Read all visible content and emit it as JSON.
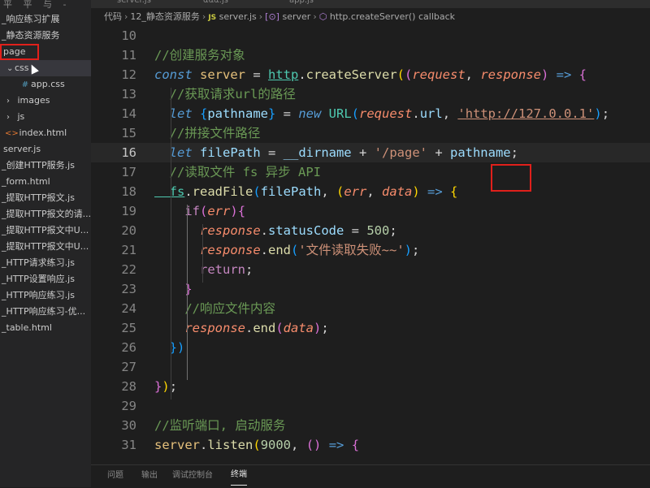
{
  "sidebar": {
    "top_text": "平 平 与 -",
    "items": [
      {
        "label": "_响应练习扩展"
      },
      {
        "label": "_静态资源服务"
      },
      {
        "label": "page"
      },
      {
        "label": "css"
      },
      {
        "label": "app.css"
      },
      {
        "label": "images"
      },
      {
        "label": "js"
      },
      {
        "label": "index.html"
      },
      {
        "label": "server.js"
      },
      {
        "label": "_创建HTTP服务.js"
      },
      {
        "label": "_form.html"
      },
      {
        "label": "_提取HTTP报文.js"
      },
      {
        "label": "_提取HTTP报文的请..."
      },
      {
        "label": "_提取HTTP报文中U..."
      },
      {
        "label": "_提取HTTP报文中U..."
      },
      {
        "label": "_HTTP请求练习.js"
      },
      {
        "label": "_HTTP设置响应.js"
      },
      {
        "label": "_HTTP响应练习.js"
      },
      {
        "label": "_HTTP响应练习-优..."
      },
      {
        "label": "_table.html"
      }
    ]
  },
  "tabs": [
    "server.js",
    "ααα.js",
    "app.js"
  ],
  "breadcrumb": {
    "parts": [
      "代码",
      "12_静态资源服务",
      "server.js",
      "server",
      "http.createServer() callback"
    ],
    "js_badge": "JS"
  },
  "editor": {
    "lines": [
      {
        "n": "10",
        "code": [
          {
            "t": "",
            "c": "pl"
          }
        ]
      },
      {
        "n": "11",
        "code": [
          {
            "t": "//创建服务对象",
            "c": "com"
          }
        ]
      },
      {
        "n": "12",
        "code": [
          {
            "t": "const ",
            "c": "kw"
          },
          {
            "t": "server",
            "c": "name"
          },
          {
            "t": " = ",
            "c": "op"
          },
          {
            "t": "http",
            "c": "type",
            "u": true
          },
          {
            "t": ".",
            "c": "pl"
          },
          {
            "t": "createServer",
            "c": "fn"
          },
          {
            "t": "(",
            "c": "br1"
          },
          {
            "t": "(",
            "c": "br2"
          },
          {
            "t": "request",
            "c": "param"
          },
          {
            "t": ", ",
            "c": "pl"
          },
          {
            "t": "response",
            "c": "param"
          },
          {
            "t": ")",
            "c": "br2"
          },
          {
            "t": " => ",
            "c": "kw"
          },
          {
            "t": "{",
            "c": "br2"
          }
        ]
      },
      {
        "n": "13",
        "code": [
          {
            "t": "  //获取请求url的路径",
            "c": "com"
          }
        ]
      },
      {
        "n": "14",
        "code": [
          {
            "t": "  let ",
            "c": "kw"
          },
          {
            "t": "{",
            "c": "br3"
          },
          {
            "t": "pathname",
            "c": "var"
          },
          {
            "t": "}",
            "c": "br3"
          },
          {
            "t": " = ",
            "c": "op"
          },
          {
            "t": "new ",
            "c": "kw"
          },
          {
            "t": "URL",
            "c": "type"
          },
          {
            "t": "(",
            "c": "br3"
          },
          {
            "t": "request",
            "c": "param"
          },
          {
            "t": ".",
            "c": "pl"
          },
          {
            "t": "url",
            "c": "var"
          },
          {
            "t": ", ",
            "c": "pl"
          },
          {
            "t": "'http://127.0.0.1'",
            "c": "str",
            "u": true
          },
          {
            "t": ")",
            "c": "br3"
          },
          {
            "t": ";",
            "c": "pl"
          }
        ]
      },
      {
        "n": "15",
        "code": [
          {
            "t": "  //拼接文件路径",
            "c": "com"
          }
        ]
      },
      {
        "n": "16",
        "active": true,
        "code": [
          {
            "t": "  let ",
            "c": "kw"
          },
          {
            "t": "filePath",
            "c": "var"
          },
          {
            "t": " = ",
            "c": "op"
          },
          {
            "t": "__dirname",
            "c": "var"
          },
          {
            "t": " + ",
            "c": "op"
          },
          {
            "t": "'/page'",
            "c": "str"
          },
          {
            "t": " + ",
            "c": "op"
          },
          {
            "t": "pathname",
            "c": "var"
          },
          {
            "t": ";",
            "c": "pl"
          }
        ]
      },
      {
        "n": "17",
        "code": [
          {
            "t": "  //读取文件 fs 异步 API",
            "c": "com"
          }
        ]
      },
      {
        "n": "18",
        "code": [
          {
            "t": "  fs",
            "c": "type",
            "u": true
          },
          {
            "t": ".",
            "c": "pl"
          },
          {
            "t": "readFile",
            "c": "fn"
          },
          {
            "t": "(",
            "c": "br3"
          },
          {
            "t": "filePath",
            "c": "var"
          },
          {
            "t": ", ",
            "c": "pl"
          },
          {
            "t": "(",
            "c": "br1"
          },
          {
            "t": "err",
            "c": "param"
          },
          {
            "t": ", ",
            "c": "pl"
          },
          {
            "t": "data",
            "c": "param"
          },
          {
            "t": ")",
            "c": "br1"
          },
          {
            "t": " => ",
            "c": "kw"
          },
          {
            "t": "{",
            "c": "br1"
          }
        ]
      },
      {
        "n": "19",
        "code": [
          {
            "t": "    if",
            "c": "kw2"
          },
          {
            "t": "(",
            "c": "br2"
          },
          {
            "t": "err",
            "c": "param"
          },
          {
            "t": ")",
            "c": "br2"
          },
          {
            "t": "{",
            "c": "br2"
          }
        ]
      },
      {
        "n": "20",
        "code": [
          {
            "t": "      response",
            "c": "param"
          },
          {
            "t": ".",
            "c": "pl"
          },
          {
            "t": "statusCode",
            "c": "var"
          },
          {
            "t": " = ",
            "c": "op"
          },
          {
            "t": "500",
            "c": "num"
          },
          {
            "t": ";",
            "c": "pl"
          }
        ]
      },
      {
        "n": "21",
        "code": [
          {
            "t": "      response",
            "c": "param"
          },
          {
            "t": ".",
            "c": "pl"
          },
          {
            "t": "end",
            "c": "fn"
          },
          {
            "t": "(",
            "c": "br3"
          },
          {
            "t": "'文件读取失败~~'",
            "c": "str"
          },
          {
            "t": ")",
            "c": "br3"
          },
          {
            "t": ";",
            "c": "pl"
          }
        ]
      },
      {
        "n": "22",
        "code": [
          {
            "t": "      return",
            "c": "kw2"
          },
          {
            "t": ";",
            "c": "pl"
          }
        ]
      },
      {
        "n": "23",
        "code": [
          {
            "t": "    }",
            "c": "br2"
          }
        ]
      },
      {
        "n": "24",
        "code": [
          {
            "t": "    //响应文件内容",
            "c": "com"
          }
        ]
      },
      {
        "n": "25",
        "code": [
          {
            "t": "    response",
            "c": "param"
          },
          {
            "t": ".",
            "c": "pl"
          },
          {
            "t": "end",
            "c": "fn"
          },
          {
            "t": "(",
            "c": "br2"
          },
          {
            "t": "data",
            "c": "param"
          },
          {
            "t": ")",
            "c": "br2"
          },
          {
            "t": ";",
            "c": "pl"
          }
        ]
      },
      {
        "n": "26",
        "code": [
          {
            "t": "  })",
            "c": "br3"
          }
        ]
      },
      {
        "n": "27",
        "code": [
          {
            "t": "",
            "c": "pl"
          }
        ]
      },
      {
        "n": "28",
        "code": [
          {
            "t": "}",
            "c": "br2"
          },
          {
            "t": ")",
            "c": "br1"
          },
          {
            "t": ";",
            "c": "pl"
          }
        ]
      },
      {
        "n": "29",
        "code": [
          {
            "t": "",
            "c": "pl"
          }
        ]
      },
      {
        "n": "30",
        "code": [
          {
            "t": "//监听端口, 启动服务",
            "c": "com"
          }
        ]
      },
      {
        "n": "31",
        "code": [
          {
            "t": "server",
            "c": "name"
          },
          {
            "t": ".",
            "c": "pl"
          },
          {
            "t": "listen",
            "c": "fn"
          },
          {
            "t": "(",
            "c": "br1"
          },
          {
            "t": "9000",
            "c": "num"
          },
          {
            "t": ", ",
            "c": "pl"
          },
          {
            "t": "()",
            "c": "br2"
          },
          {
            "t": " => ",
            "c": "kw"
          },
          {
            "t": "{",
            "c": "br2"
          }
        ]
      }
    ]
  },
  "panel": {
    "tabs": [
      "问题",
      "输出",
      "调试控制台",
      "终端"
    ],
    "active": "终端"
  }
}
